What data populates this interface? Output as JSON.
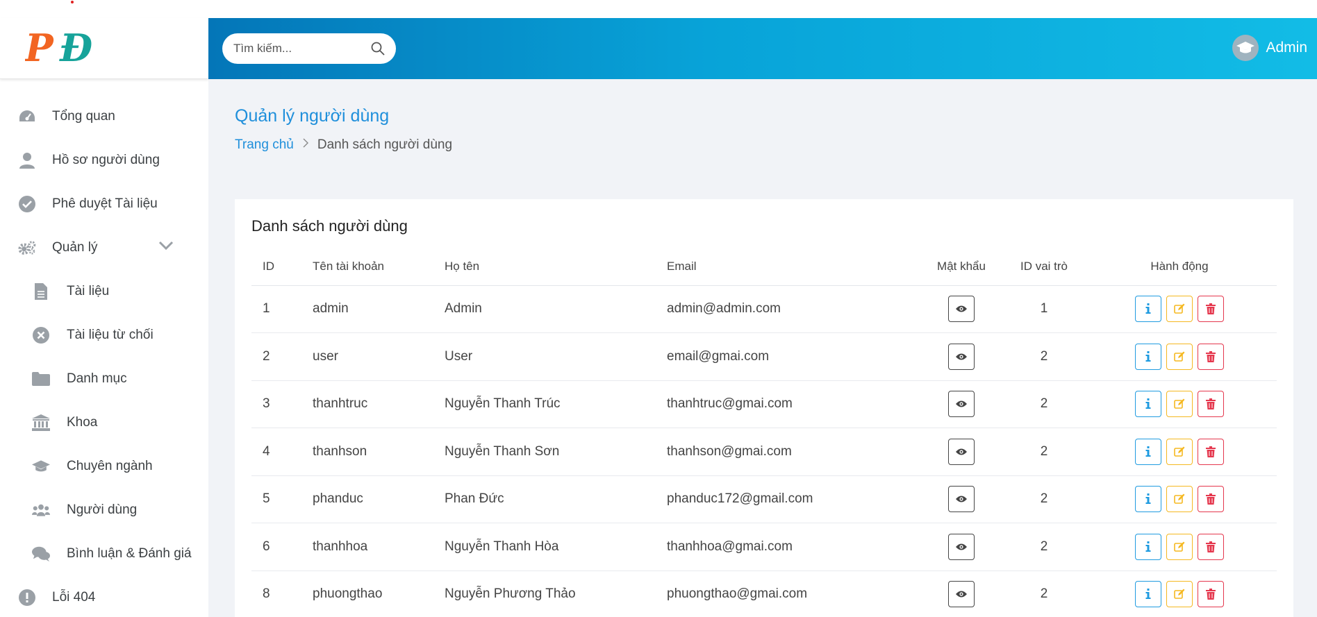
{
  "header": {
    "search_placeholder": "Tìm kiếm...",
    "user_name": "Admin"
  },
  "sidebar": {
    "logo_text": "PĐ",
    "items": [
      {
        "label": "Tổng quan",
        "icon": "dashboard-icon"
      },
      {
        "label": "Hồ sơ người dùng",
        "icon": "user-icon"
      },
      {
        "label": "Phê duyệt Tài liệu",
        "icon": "check-circle-icon"
      },
      {
        "label": "Quản lý",
        "icon": "gears-icon"
      },
      {
        "label": "Tài liệu",
        "icon": "file-icon"
      },
      {
        "label": "Tài liệu từ chối",
        "icon": "times-circle-icon"
      },
      {
        "label": "Danh mục",
        "icon": "folder-icon"
      },
      {
        "label": "Khoa",
        "icon": "university-icon"
      },
      {
        "label": "Chuyên ngành",
        "icon": "graduation-cap-icon"
      },
      {
        "label": "Người dùng",
        "icon": "users-icon"
      },
      {
        "label": "Bình luận & Đánh giá",
        "icon": "comments-icon"
      },
      {
        "label": "Lỗi 404",
        "icon": "exclamation-circle-icon"
      }
    ]
  },
  "main": {
    "title": "Quản lý người dùng",
    "breadcrumb": {
      "home": "Trang chủ",
      "current": "Danh sách người dùng"
    },
    "card_title": "Danh sách người dùng",
    "columns": [
      "ID",
      "Tên tài khoản",
      "Họ tên",
      "Email",
      "Mật khẩu",
      "ID vai trò",
      "Hành động"
    ],
    "rows": [
      {
        "id": "1",
        "username": "admin",
        "name": "Admin",
        "email": "admin@admin.com",
        "role": "1"
      },
      {
        "id": "2",
        "username": "user",
        "name": "User",
        "email": "email@gmai.com",
        "role": "2"
      },
      {
        "id": "3",
        "username": "thanhtruc",
        "name": "Nguyễn Thanh Trúc",
        "email": "thanhtruc@gmai.com",
        "role": "2"
      },
      {
        "id": "4",
        "username": "thanhson",
        "name": "Nguyễn Thanh Sơn",
        "email": "thanhson@gmai.com",
        "role": "2"
      },
      {
        "id": "5",
        "username": "phanduc",
        "name": "Phan Đức",
        "email": "phanduc172@gmail.com",
        "role": "2"
      },
      {
        "id": "6",
        "username": "thanhhoa",
        "name": "Nguyễn Thanh Hòa",
        "email": "thanhhoa@gmai.com",
        "role": "2"
      },
      {
        "id": "8",
        "username": "phuongthao",
        "name": "Nguyễn Phương Thảo",
        "email": "phuongthao@gmai.com",
        "role": "2"
      }
    ]
  },
  "colors": {
    "primary": "#1f8fdb",
    "header_start": "#0476b8",
    "header_end": "#12bce6",
    "info": "#1f9be0",
    "warning": "#f5b820",
    "danger": "#e5374d",
    "logo_orange": "#f26522",
    "logo_teal": "#16a39a"
  }
}
